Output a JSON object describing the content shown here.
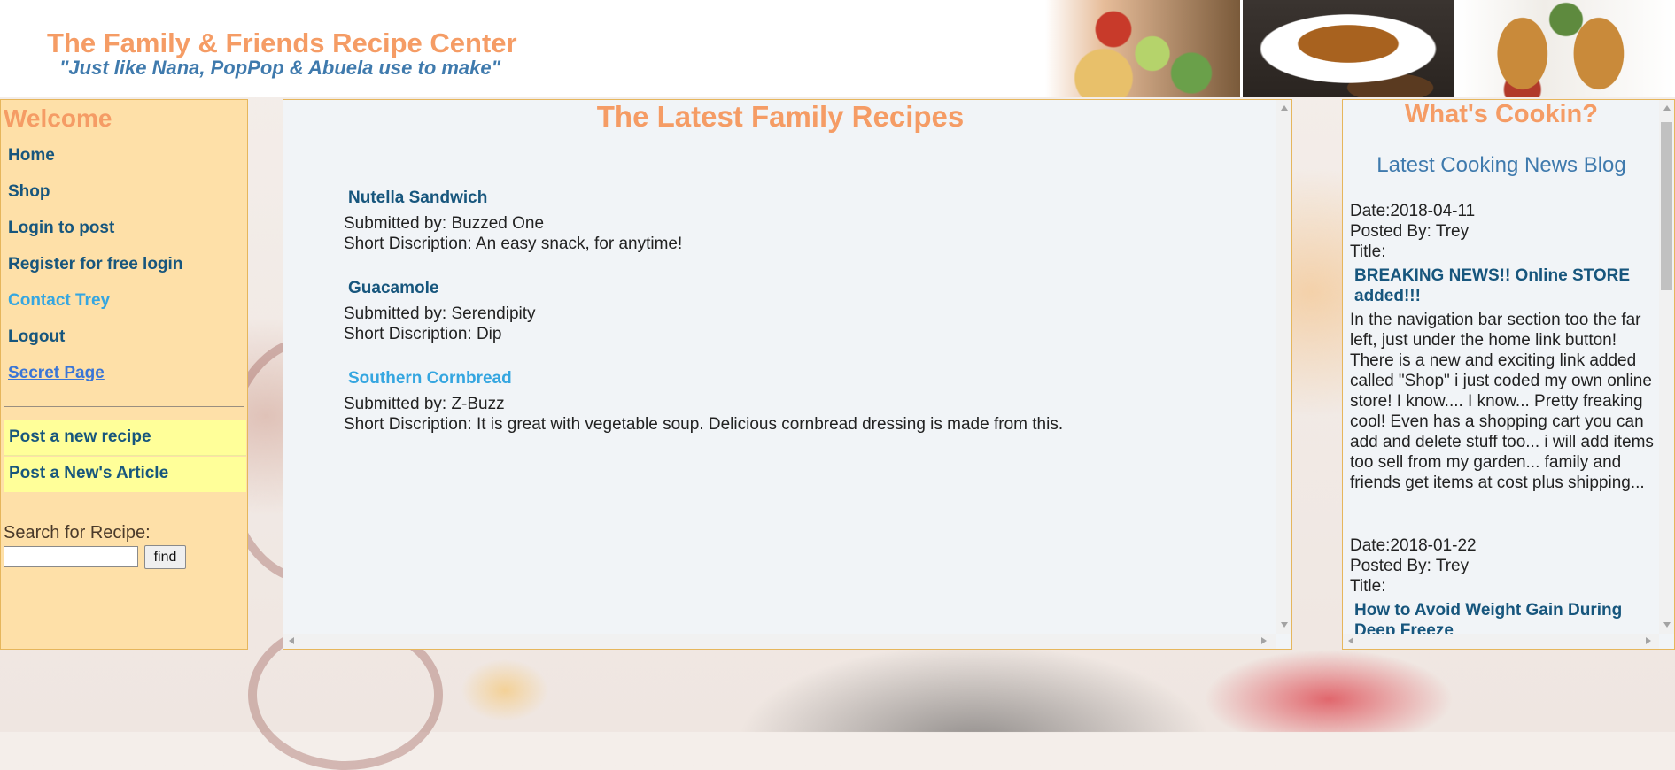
{
  "header": {
    "title": "The Family & Friends Recipe Center",
    "tagline": "\"Just like Nana, PopPop & Abuela use to make\""
  },
  "sidebar": {
    "heading": "Welcome",
    "nav": [
      "Home",
      "Shop",
      "Login to post",
      "Register for free login",
      "Contact Trey",
      "Logout",
      "Secret Page"
    ],
    "post_links": [
      "Post a new recipe",
      "Post a New's Article"
    ],
    "search_label": "Search for Recipe:",
    "search_value": "",
    "find_label": "find"
  },
  "main": {
    "heading": "The Latest Family Recipes",
    "recipes": [
      {
        "name": "Nutella Sandwich",
        "submitted": "Submitted by: Buzzed One",
        "description": "Short Discription: An easy snack, for anytime!"
      },
      {
        "name": "Guacamole",
        "submitted": "Submitted by: Serendipity",
        "description": "Short Discription: Dip"
      },
      {
        "name": "Southern Cornbread",
        "submitted": "Submitted by: Z-Buzz",
        "description": "Short Discription: It is great with vegetable soup. Delicious cornbread dressing is made from this."
      }
    ]
  },
  "blog": {
    "heading": "What's Cookin?",
    "subheading": "Latest Cooking News Blog",
    "posts": [
      {
        "date": "Date:2018-04-11",
        "posted_by": "Posted By: Trey",
        "title_label": "Title:",
        "title": "BREAKING NEWS!! Online STORE added!!!",
        "body": "In the navigation bar section too the far left, just under the home link button! There is a new and exciting link added called \"Shop\" i just coded my own online store! I know.... I know... Pretty freaking cool! Even has a shopping cart you can add and delete stuff too... i will add items too sell from my garden... family and friends get items at cost plus shipping..."
      },
      {
        "date": "Date:2018-01-22",
        "posted_by": "Posted By: Trey",
        "title_label": "Title:",
        "title": "How to Avoid Weight Gain During Deep Freeze"
      }
    ]
  },
  "colors": {
    "accent_orange": "#f59c65",
    "link_blue": "#17567d",
    "sidebar_bg": "#fee0a8",
    "post_link_bg": "#ffff99"
  }
}
